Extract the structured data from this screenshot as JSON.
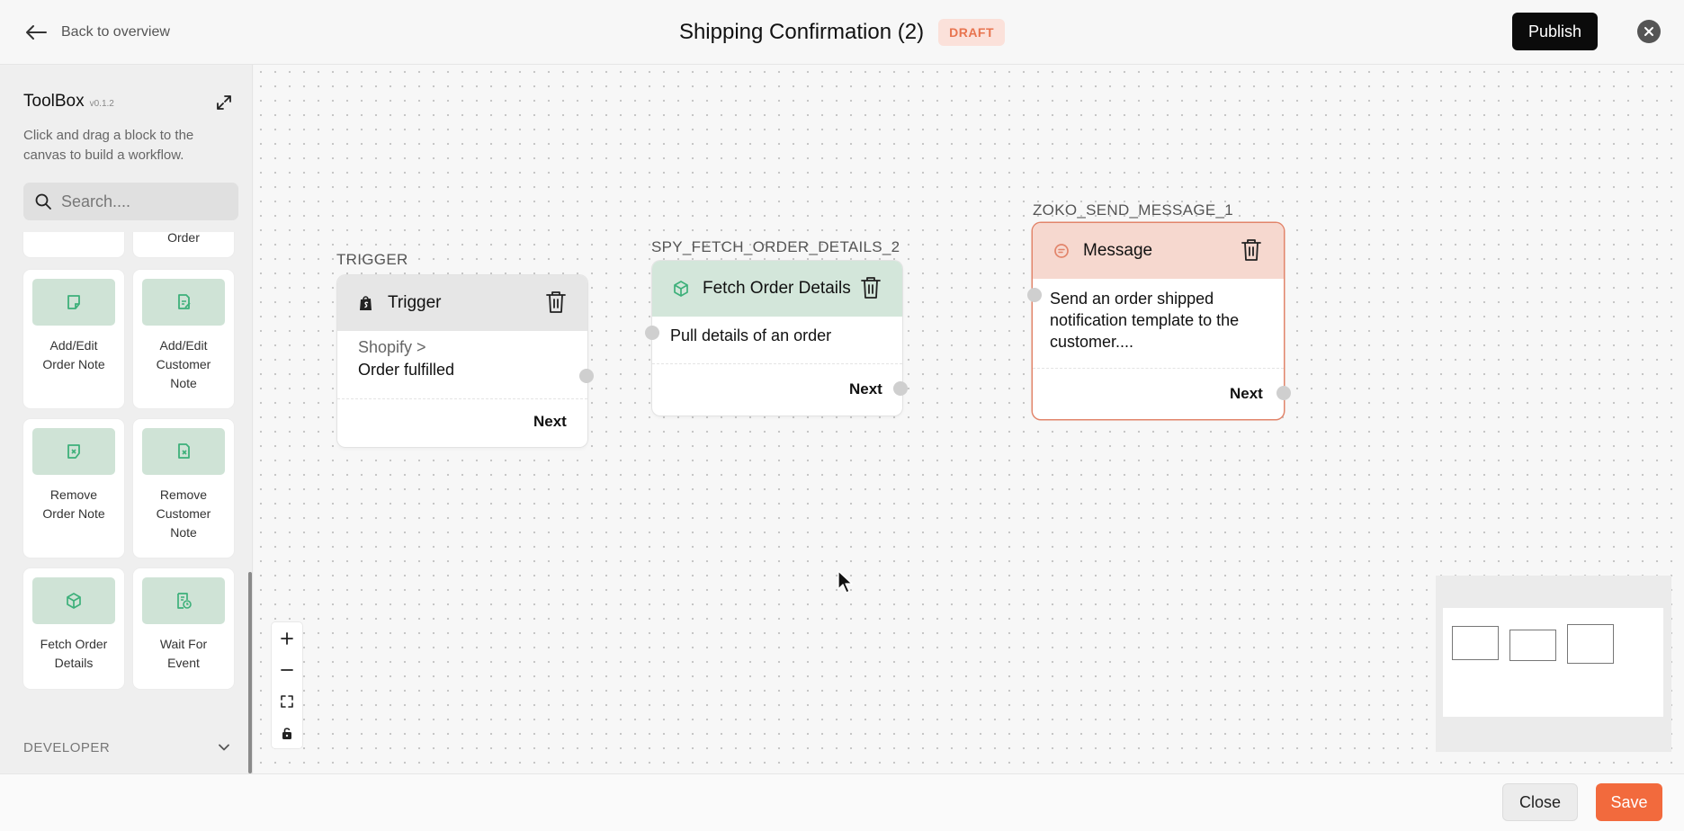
{
  "header": {
    "back_label": "Back to overview",
    "title": "Shipping Confirmation (2)",
    "status_badge": "DRAFT",
    "publish_label": "Publish"
  },
  "sidebar": {
    "title": "ToolBox",
    "version": "v0.1.2",
    "description": "Click and drag a block to the canvas to build a workflow.",
    "search_placeholder": "Search....",
    "blocks": [
      {
        "label": "Order",
        "icon": "order-icon"
      },
      {
        "label": "Add/Edit Order Note",
        "icon": "note-edit-icon"
      },
      {
        "label": "Add/Edit Customer Note",
        "icon": "customer-note-edit-icon"
      },
      {
        "label": "Remove Order Note",
        "icon": "note-remove-icon"
      },
      {
        "label": "Remove Customer Note",
        "icon": "customer-note-remove-icon"
      },
      {
        "label": "Fetch Order Details",
        "icon": "cube-icon"
      },
      {
        "label": "Wait For Event",
        "icon": "wait-event-icon"
      }
    ],
    "developer_label": "DEVELOPER"
  },
  "canvas": {
    "nodes": [
      {
        "id_label": "TRIGGER",
        "title": "Trigger",
        "icon": "shopify-icon",
        "source": "Shopify >",
        "event": "Order fulfilled",
        "next_label": "Next",
        "header_color": "#e6e6e6"
      },
      {
        "id_label": "SPY_FETCH_ORDER_DETAILS_2",
        "title": "Fetch Order Details",
        "icon": "cube-icon",
        "description": "Pull details of an order",
        "next_label": "Next",
        "header_color": "#d3e6da"
      },
      {
        "id_label": "ZOKO_SEND_MESSAGE_1",
        "title": "Message",
        "icon": "message-icon",
        "description": "Send an order shipped notification template to the customer....",
        "next_label": "Next",
        "header_color": "#f6d8cf",
        "border_color": "#e2846a"
      }
    ]
  },
  "footer": {
    "close_label": "Close",
    "save_label": "Save"
  },
  "colors": {
    "accent": "#f26a3d",
    "block_icon_bg": "#cfe3d6",
    "block_icon": "#3db07a"
  }
}
